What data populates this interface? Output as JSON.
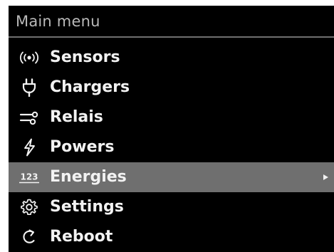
{
  "header": {
    "title": "Main menu"
  },
  "menu": {
    "items": [
      {
        "label": "Sensors",
        "icon": "sensor-signal-icon"
      },
      {
        "label": "Chargers",
        "icon": "plug-icon"
      },
      {
        "label": "Relais",
        "icon": "relay-switch-icon"
      },
      {
        "label": "Powers",
        "icon": "lightning-icon"
      },
      {
        "label": "Energies",
        "icon": "numbers-123-icon",
        "selected": true,
        "has_submenu": true,
        "icon_text": "123"
      },
      {
        "label": "Settings",
        "icon": "gear-icon"
      },
      {
        "label": "Reboot",
        "icon": "reboot-icon"
      }
    ]
  },
  "colors": {
    "background": "#000000",
    "text": "#f2f2f2",
    "title_text": "#b9b9b9",
    "selection": "#6f6f6f"
  }
}
